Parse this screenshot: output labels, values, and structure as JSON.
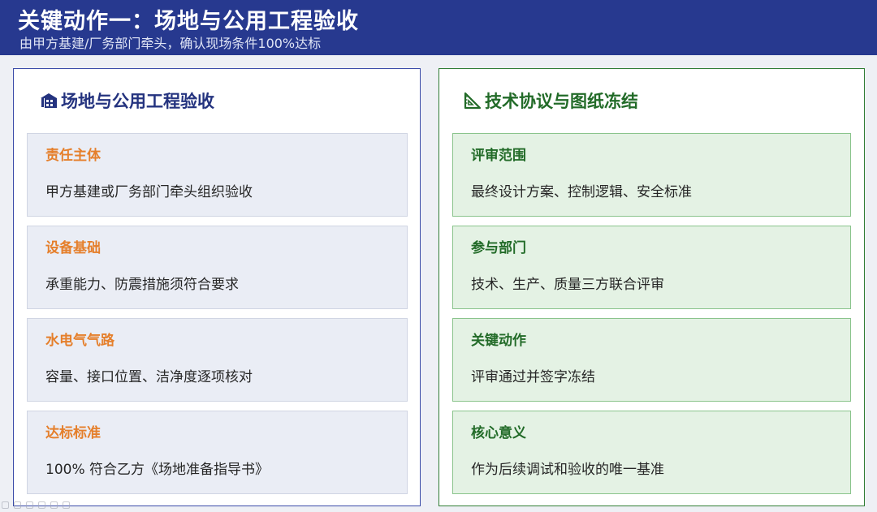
{
  "header": {
    "title": "关键动作一：场地与公用工程验收",
    "subtitle": "由甲方基建/厂务部门牵头，确认现场条件100%达标"
  },
  "left_panel": {
    "icon": "building-icon",
    "title": "场地与公用工程验收",
    "cards": [
      {
        "label": "责任主体",
        "text": "甲方基建或厂务部门牵头组织验收"
      },
      {
        "label": "设备基础",
        "text": "承重能力、防震措施须符合要求"
      },
      {
        "label": "水电气气路",
        "text": "容量、接口位置、洁净度逐项核对"
      },
      {
        "label": "达标标准",
        "text": "100% 符合乙方《场地准备指导书》"
      }
    ]
  },
  "right_panel": {
    "icon": "set-square-icon",
    "title": "技术协议与图纸冻结",
    "cards": [
      {
        "label": "评审范围",
        "text": "最终设计方案、控制逻辑、安全标准"
      },
      {
        "label": "参与部门",
        "text": "技术、生产、质量三方联合评审"
      },
      {
        "label": "关键动作",
        "text": "评审通过并签字冻结"
      },
      {
        "label": "核心意义",
        "text": "作为后续调试和验收的唯一基准"
      }
    ]
  },
  "colors": {
    "header_bg": "#27398f",
    "left_accent": "#3a4ba8",
    "left_label": "#e57f2b",
    "right_accent": "#2f7d34",
    "right_label": "#226b28",
    "right_card_bg": "#e4f2e4",
    "left_card_bg": "#eaedf5"
  }
}
